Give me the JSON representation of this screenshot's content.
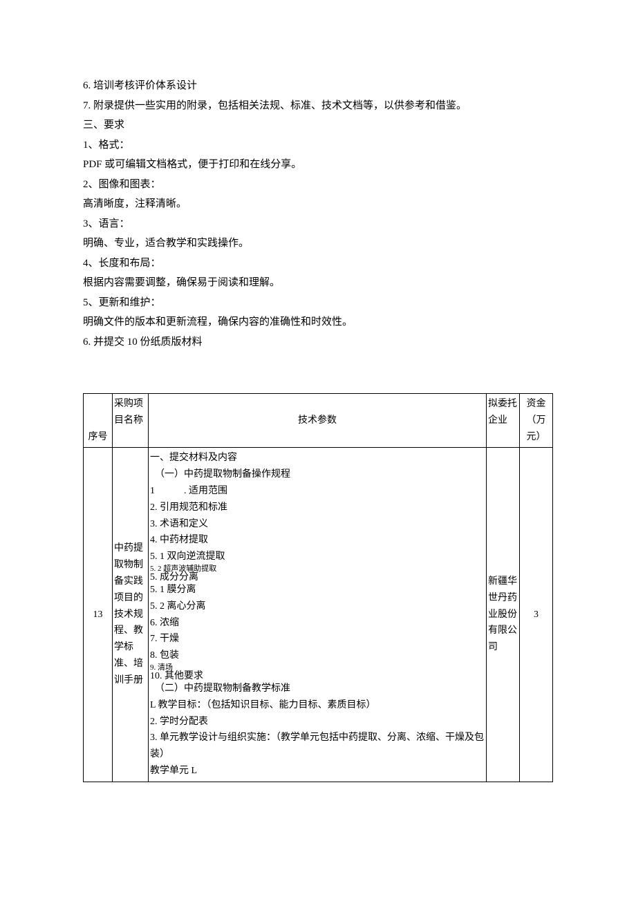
{
  "text_block": {
    "lines": [
      "6. 培训考核评价体系设计",
      "7. 附录提供一些实用的附录，包括相关法规、标准、技术文档等，以供参考和借鉴。",
      "三、要求",
      "1、格式：",
      "PDF 或可编辑文档格式，便于打印和在线分享。",
      "2、图像和图表：",
      "高清晰度，注释清晰。",
      "3、语言：",
      "明确、专业，适合教学和实践操作。",
      "4、长度和布局：",
      "根据内容需要调整，确保易于阅读和理解。",
      "5、更新和维护：",
      "明确文件的版本和更新流程，确保内容的准确性和时效性。",
      "6. 并提交 10 份纸质版材料"
    ]
  },
  "table": {
    "headers": {
      "seq": "序号",
      "name_l1": "采购项",
      "name_l2": "目名称",
      "tech": "技术参数",
      "company_l1": "拟委托",
      "company_l2": "企业",
      "fund_l1": "资金",
      "fund_l2": "（万",
      "fund_l3": "元）"
    },
    "row": {
      "seq": "13",
      "name": "中药提取物制备实践项目的技术规程、教学标准、培训手册",
      "tech": {
        "t1": "一、提交材料及内容",
        "t2": "　（一）中药提取物制备操作规程",
        "t3": "1　　　. 适用范围",
        "t4": "2. 引用规范和标准",
        "t5": "3. 术语和定义",
        "t6": "4. 中药材提取",
        "t7": "5. 1 双向逆流提取",
        "t8a": "5. 2 超声波辅助提取",
        "t8b": "5. 成分分离",
        "t9": "5. 1 膜分离",
        "t10": "5. 2 离心分离",
        "t11": "6. 浓缩",
        "t12": "7. 干燥",
        "t13": "8. 包装",
        "t14a": "9. 清场",
        "t14b": "10. 其他要求",
        "t15": "　（二）中药提取物制备教学标准",
        "t16": "L 教学目标：（包括知识目标、能力目标、素质目标）",
        "t17": "2. 学时分配表",
        "t18": "3. 单元教学设计与组织实施：（教学单元包括中药提取、分离、浓缩、干燥及包装）",
        "t19": "教学单元 L"
      },
      "company": "新疆华世丹药业股份有限公司",
      "fund": "3"
    }
  }
}
